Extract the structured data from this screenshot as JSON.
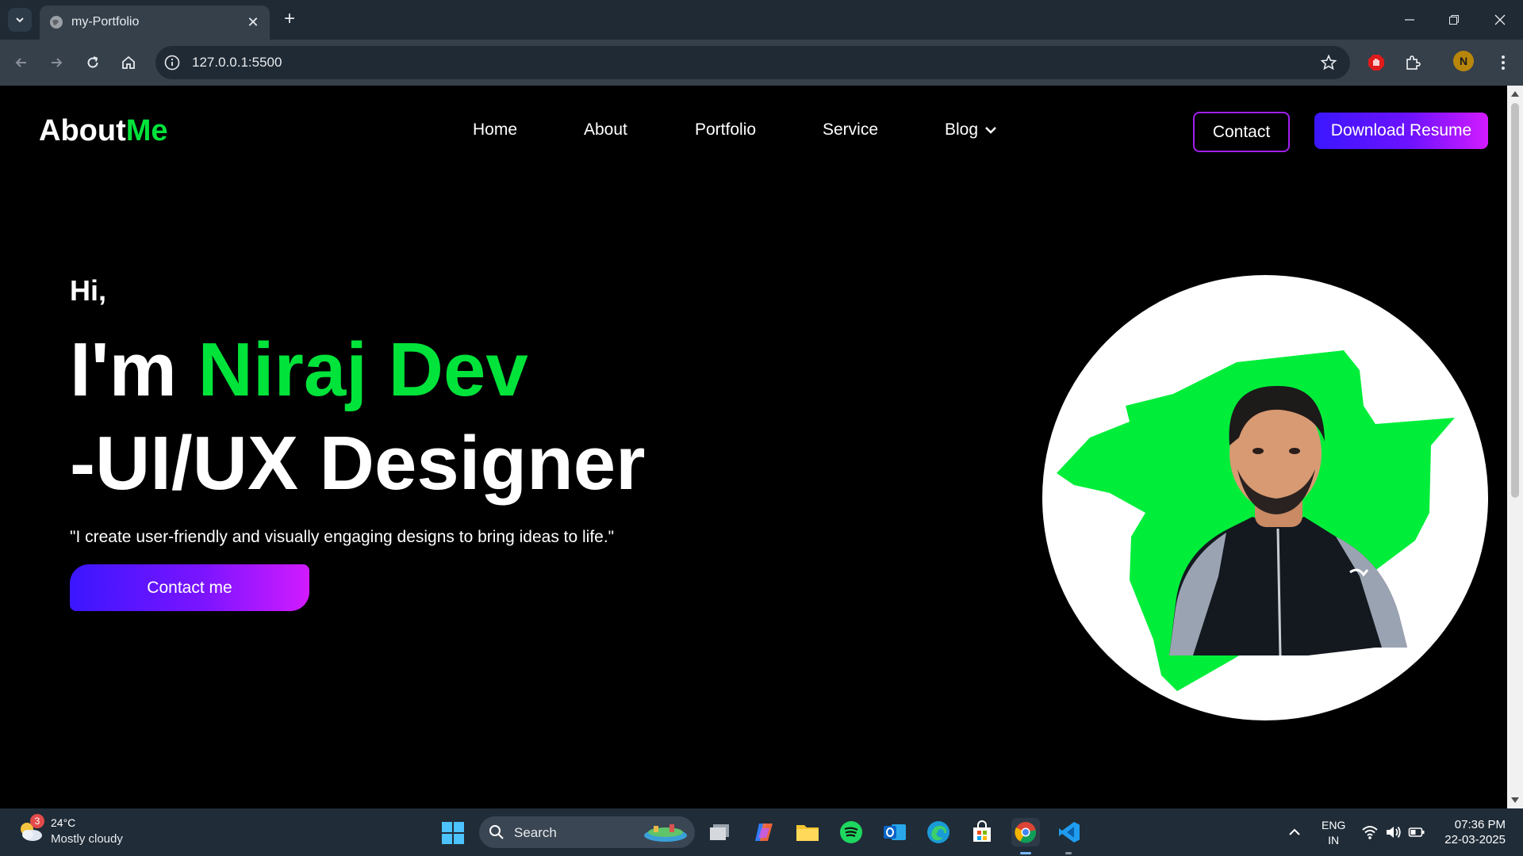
{
  "browser": {
    "tab_title": "my-Portfolio",
    "url": "127.0.0.1:5500",
    "profile_initial": "N"
  },
  "site": {
    "logo_main": "About",
    "logo_accent": "Me",
    "nav": [
      "Home",
      "About",
      "Portfolio",
      "Service",
      "Blog"
    ],
    "contact_button": "Contact",
    "resume_button": "Download Resume"
  },
  "hero": {
    "greeting": "Hi,",
    "intro": "I'm ",
    "name": "Niraj Dev",
    "role": "-UI/UX Designer",
    "tagline": "\"I create user-friendly and visually engaging designs to bring ideas to life.\"",
    "cta": "Contact me"
  },
  "taskbar": {
    "weather_badge": "3",
    "weather_temp": "24°C",
    "weather_desc": "Mostly cloudy",
    "search_label": "Search",
    "lang_top": "ENG",
    "lang_bottom": "IN",
    "time": "07:36 PM",
    "date": "22-03-2025"
  },
  "colors": {
    "accent_green": "#00e33a",
    "accent_purple": "#a020f0",
    "gradient_start": "#3b16ff",
    "gradient_end": "#d21bff"
  }
}
